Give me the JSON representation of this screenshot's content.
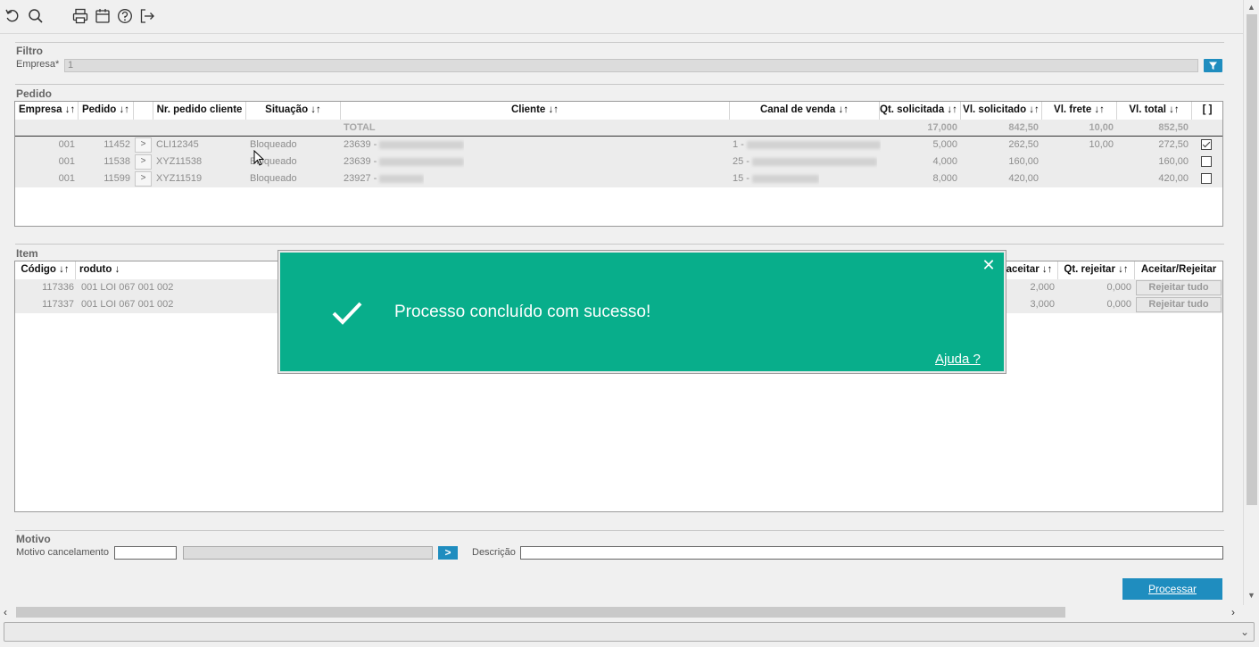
{
  "toolbar": {
    "icons": [
      "refresh-icon",
      "search-icon",
      "print-icon",
      "calendar-icon",
      "help-icon",
      "exit-icon"
    ]
  },
  "filtro": {
    "title": "Filtro",
    "empresa_label": "Empresa*",
    "empresa_value": "1"
  },
  "pedido": {
    "title": "Pedido",
    "columns": [
      "Empresa ↓↑",
      "Pedido ↓↑",
      "Nr. pedido cliente",
      "Situação ↓↑",
      "Cliente ↓↑",
      "Canal de venda ↓↑",
      "Qt. solicitada ↓↑",
      "Vl. solicitado ↓↑",
      "Vl. frete ↓↑",
      "Vl. total ↓↑",
      "[ ]"
    ],
    "total": {
      "label": "TOTAL",
      "qt_solicitada": "17,000",
      "vl_solicitado": "842,50",
      "vl_frete": "10,00",
      "vl_total": "852,50"
    },
    "rows": [
      {
        "empresa": "001",
        "pedido": "11452",
        "go": ">",
        "nr_cliente": "CLI12345",
        "situacao": "Bloqueado",
        "cliente": "23639 -",
        "canal": "1 -",
        "qt": "5,000",
        "vl_sol": "262,50",
        "vl_frete": "10,00",
        "vl_total": "272,50",
        "checked": true
      },
      {
        "empresa": "001",
        "pedido": "11538",
        "go": ">",
        "nr_cliente": "XYZ11538",
        "situacao": "Bloqueado",
        "cliente": "23639 -",
        "canal": "25 -",
        "qt": "4,000",
        "vl_sol": "160,00",
        "vl_frete": "",
        "vl_total": "160,00",
        "checked": false
      },
      {
        "empresa": "001",
        "pedido": "11599",
        "go": ">",
        "nr_cliente": "XYZ11519",
        "situacao": "Bloqueado",
        "cliente": "23927 -",
        "canal": "15 -",
        "qt": "8,000",
        "vl_sol": "420,00",
        "vl_frete": "",
        "vl_total": "420,00",
        "checked": false
      }
    ]
  },
  "item": {
    "title": "Item",
    "columns": [
      "Código ↓↑",
      "roduto ↓",
      "aceitar ↓↑",
      "Qt. rejeitar ↓↑",
      "Aceitar/Rejeitar"
    ],
    "rows": [
      {
        "codigo": "117336",
        "produto": "001 LOI 067 001 002",
        "aceitar": "2,000",
        "rejeitar": "0,000",
        "action": "Rejeitar tudo"
      },
      {
        "codigo": "117337",
        "produto": "001 LOI 067 001 002",
        "aceitar": "3,000",
        "rejeitar": "0,000",
        "action": "Rejeitar tudo"
      }
    ]
  },
  "motivo": {
    "title": "Motivo",
    "cancel_label": "Motivo cancelamento",
    "cancel_code": "",
    "cancel_desc": "",
    "go": ">",
    "descricao_label": "Descrição",
    "descricao_value": ""
  },
  "toast": {
    "message": "Processo concluído com sucesso!",
    "help_link": "Ajuda ?",
    "close": "✕",
    "color": "#08ae8b"
  },
  "actions": {
    "processar": "Processar"
  },
  "colors": {
    "accent": "#1f8dbf",
    "success": "#08ae8b"
  }
}
